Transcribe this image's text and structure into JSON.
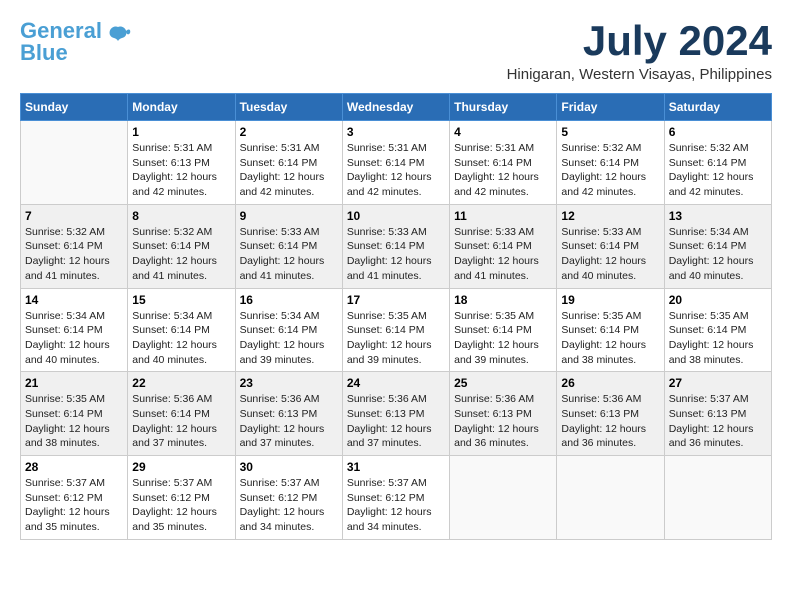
{
  "logo": {
    "general": "General",
    "blue": "Blue"
  },
  "header": {
    "month": "July 2024",
    "location": "Hinigaran, Western Visayas, Philippines"
  },
  "weekdays": [
    "Sunday",
    "Monday",
    "Tuesday",
    "Wednesday",
    "Thursday",
    "Friday",
    "Saturday"
  ],
  "weeks": [
    [
      {
        "day": "",
        "info": ""
      },
      {
        "day": "1",
        "info": "Sunrise: 5:31 AM\nSunset: 6:13 PM\nDaylight: 12 hours\nand 42 minutes."
      },
      {
        "day": "2",
        "info": "Sunrise: 5:31 AM\nSunset: 6:14 PM\nDaylight: 12 hours\nand 42 minutes."
      },
      {
        "day": "3",
        "info": "Sunrise: 5:31 AM\nSunset: 6:14 PM\nDaylight: 12 hours\nand 42 minutes."
      },
      {
        "day": "4",
        "info": "Sunrise: 5:31 AM\nSunset: 6:14 PM\nDaylight: 12 hours\nand 42 minutes."
      },
      {
        "day": "5",
        "info": "Sunrise: 5:32 AM\nSunset: 6:14 PM\nDaylight: 12 hours\nand 42 minutes."
      },
      {
        "day": "6",
        "info": "Sunrise: 5:32 AM\nSunset: 6:14 PM\nDaylight: 12 hours\nand 42 minutes."
      }
    ],
    [
      {
        "day": "7",
        "info": "Sunrise: 5:32 AM\nSunset: 6:14 PM\nDaylight: 12 hours\nand 41 minutes."
      },
      {
        "day": "8",
        "info": "Sunrise: 5:32 AM\nSunset: 6:14 PM\nDaylight: 12 hours\nand 41 minutes."
      },
      {
        "day": "9",
        "info": "Sunrise: 5:33 AM\nSunset: 6:14 PM\nDaylight: 12 hours\nand 41 minutes."
      },
      {
        "day": "10",
        "info": "Sunrise: 5:33 AM\nSunset: 6:14 PM\nDaylight: 12 hours\nand 41 minutes."
      },
      {
        "day": "11",
        "info": "Sunrise: 5:33 AM\nSunset: 6:14 PM\nDaylight: 12 hours\nand 41 minutes."
      },
      {
        "day": "12",
        "info": "Sunrise: 5:33 AM\nSunset: 6:14 PM\nDaylight: 12 hours\nand 40 minutes."
      },
      {
        "day": "13",
        "info": "Sunrise: 5:34 AM\nSunset: 6:14 PM\nDaylight: 12 hours\nand 40 minutes."
      }
    ],
    [
      {
        "day": "14",
        "info": "Sunrise: 5:34 AM\nSunset: 6:14 PM\nDaylight: 12 hours\nand 40 minutes."
      },
      {
        "day": "15",
        "info": "Sunrise: 5:34 AM\nSunset: 6:14 PM\nDaylight: 12 hours\nand 40 minutes."
      },
      {
        "day": "16",
        "info": "Sunrise: 5:34 AM\nSunset: 6:14 PM\nDaylight: 12 hours\nand 39 minutes."
      },
      {
        "day": "17",
        "info": "Sunrise: 5:35 AM\nSunset: 6:14 PM\nDaylight: 12 hours\nand 39 minutes."
      },
      {
        "day": "18",
        "info": "Sunrise: 5:35 AM\nSunset: 6:14 PM\nDaylight: 12 hours\nand 39 minutes."
      },
      {
        "day": "19",
        "info": "Sunrise: 5:35 AM\nSunset: 6:14 PM\nDaylight: 12 hours\nand 38 minutes."
      },
      {
        "day": "20",
        "info": "Sunrise: 5:35 AM\nSunset: 6:14 PM\nDaylight: 12 hours\nand 38 minutes."
      }
    ],
    [
      {
        "day": "21",
        "info": "Sunrise: 5:35 AM\nSunset: 6:14 PM\nDaylight: 12 hours\nand 38 minutes."
      },
      {
        "day": "22",
        "info": "Sunrise: 5:36 AM\nSunset: 6:14 PM\nDaylight: 12 hours\nand 37 minutes."
      },
      {
        "day": "23",
        "info": "Sunrise: 5:36 AM\nSunset: 6:13 PM\nDaylight: 12 hours\nand 37 minutes."
      },
      {
        "day": "24",
        "info": "Sunrise: 5:36 AM\nSunset: 6:13 PM\nDaylight: 12 hours\nand 37 minutes."
      },
      {
        "day": "25",
        "info": "Sunrise: 5:36 AM\nSunset: 6:13 PM\nDaylight: 12 hours\nand 36 minutes."
      },
      {
        "day": "26",
        "info": "Sunrise: 5:36 AM\nSunset: 6:13 PM\nDaylight: 12 hours\nand 36 minutes."
      },
      {
        "day": "27",
        "info": "Sunrise: 5:37 AM\nSunset: 6:13 PM\nDaylight: 12 hours\nand 36 minutes."
      }
    ],
    [
      {
        "day": "28",
        "info": "Sunrise: 5:37 AM\nSunset: 6:12 PM\nDaylight: 12 hours\nand 35 minutes."
      },
      {
        "day": "29",
        "info": "Sunrise: 5:37 AM\nSunset: 6:12 PM\nDaylight: 12 hours\nand 35 minutes."
      },
      {
        "day": "30",
        "info": "Sunrise: 5:37 AM\nSunset: 6:12 PM\nDaylight: 12 hours\nand 34 minutes."
      },
      {
        "day": "31",
        "info": "Sunrise: 5:37 AM\nSunset: 6:12 PM\nDaylight: 12 hours\nand 34 minutes."
      },
      {
        "day": "",
        "info": ""
      },
      {
        "day": "",
        "info": ""
      },
      {
        "day": "",
        "info": ""
      }
    ]
  ]
}
